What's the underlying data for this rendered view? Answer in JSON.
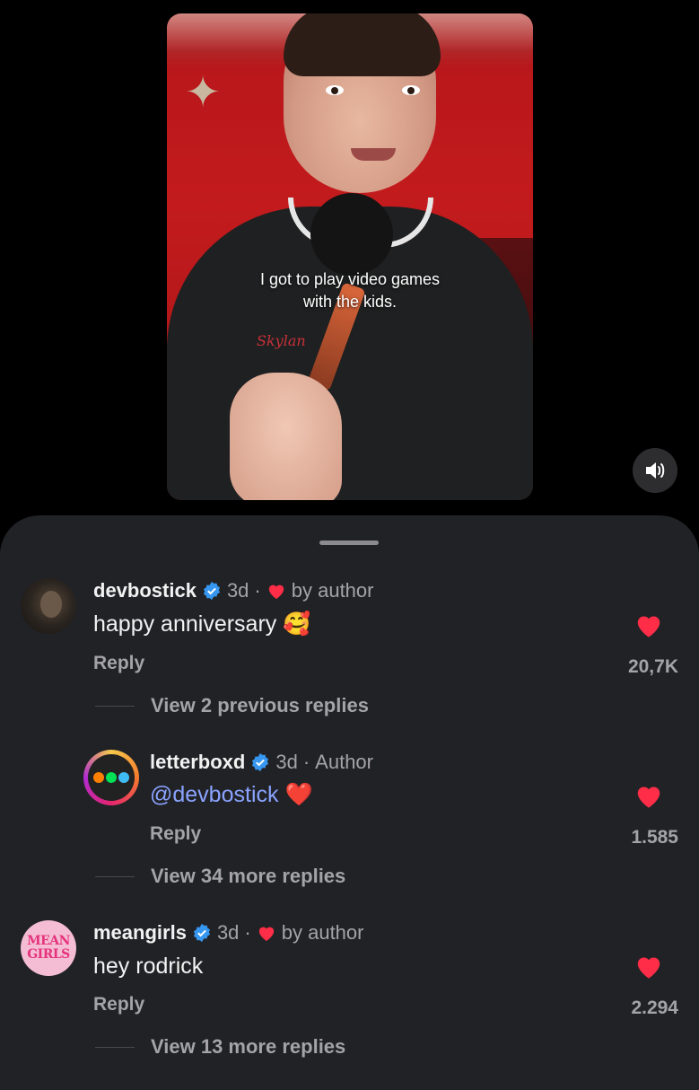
{
  "video": {
    "caption_line1": "I got to play video games",
    "caption_line2": "with the kids.",
    "sweater_text": "Skylan"
  },
  "comments": [
    {
      "username": "devbostick",
      "verified": true,
      "time": "3d",
      "badge": "by author",
      "text": "happy anniversary",
      "emoji": "🥰",
      "reply_label": "Reply",
      "likes": "20,7K",
      "view_more": "View 2 previous replies"
    },
    {
      "username": "letterboxd",
      "verified": true,
      "time": "3d",
      "badge": "Author",
      "mention": "@devbostick",
      "emoji": "❤️",
      "reply_label": "Reply",
      "likes": "1.585",
      "view_more": "View 34 more replies"
    },
    {
      "username": "meangirls",
      "verified": true,
      "time": "3d",
      "badge": "by author",
      "text": "hey rodrick",
      "reply_label": "Reply",
      "likes": "2.294",
      "view_more": "View 13 more replies",
      "avatar_text_1": "MEAN",
      "avatar_text_2": "GIRLS"
    }
  ],
  "colors": {
    "heart": "#ff2d47",
    "verified": "#3797f0",
    "mention": "#8aa3ff",
    "sheet_bg": "#212226"
  },
  "icons": [
    "speaker-icon",
    "verified-icon",
    "heart-icon"
  ]
}
